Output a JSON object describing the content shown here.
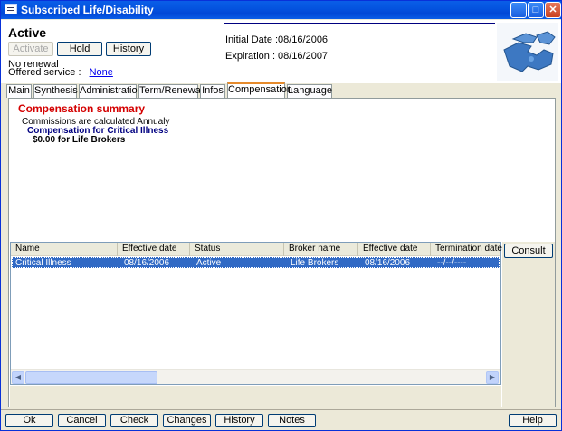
{
  "window": {
    "title": "Subscribed Life/Disability"
  },
  "header": {
    "status": "Active",
    "activate_label": "Activate",
    "hold_label": "Hold",
    "history_label": "History",
    "renewal_text": "No renewal",
    "offered_service_label": "Offered service :",
    "offered_service_value": "None",
    "initial_date_label": "Initial Date :",
    "initial_date_value": "08/16/2006",
    "expiration_label": "Expiration :",
    "expiration_value": "08/16/2007"
  },
  "tabs": [
    {
      "label": "Main"
    },
    {
      "label": "Synthesis"
    },
    {
      "label": "Administration"
    },
    {
      "label": "Term/Renewal"
    },
    {
      "label": "Infos"
    },
    {
      "label": "Compensation"
    },
    {
      "label": "Language"
    }
  ],
  "active_tab": "Compensation",
  "summary": {
    "title": "Compensation summary",
    "calc_text": "Commissions are calculated Annualy",
    "subtitle": "Compensation for Critical Illness",
    "amount_text": "$0.00 for Life Brokers"
  },
  "table": {
    "columns": [
      "Name",
      "Effective date",
      "Status",
      "Broker name",
      "Effective date",
      "Termination date"
    ],
    "rows": [
      [
        "Critical Illness",
        "08/16/2006",
        "Active",
        "Life Brokers",
        "08/16/2006",
        "--/--/----"
      ]
    ]
  },
  "side": {
    "consult_label": "Consult"
  },
  "footer": {
    "ok_label": "Ok",
    "cancel_label": "Cancel",
    "check_label": "Check",
    "changes_label": "Changes",
    "history_label": "History",
    "notes_label": "Notes",
    "help_label": "Help"
  },
  "colors": {
    "title_bar": "#0454e0",
    "summary_title": "#d40000",
    "summary_subtitle": "#000080",
    "selected_row": "#316ac5",
    "active_tab_accent": "#e68b2c"
  },
  "icons": [
    "window-icon",
    "minimize-icon",
    "maximize-icon",
    "close-icon",
    "puzzle-logo-icon",
    "scroll-left-icon",
    "scroll-right-icon"
  ]
}
